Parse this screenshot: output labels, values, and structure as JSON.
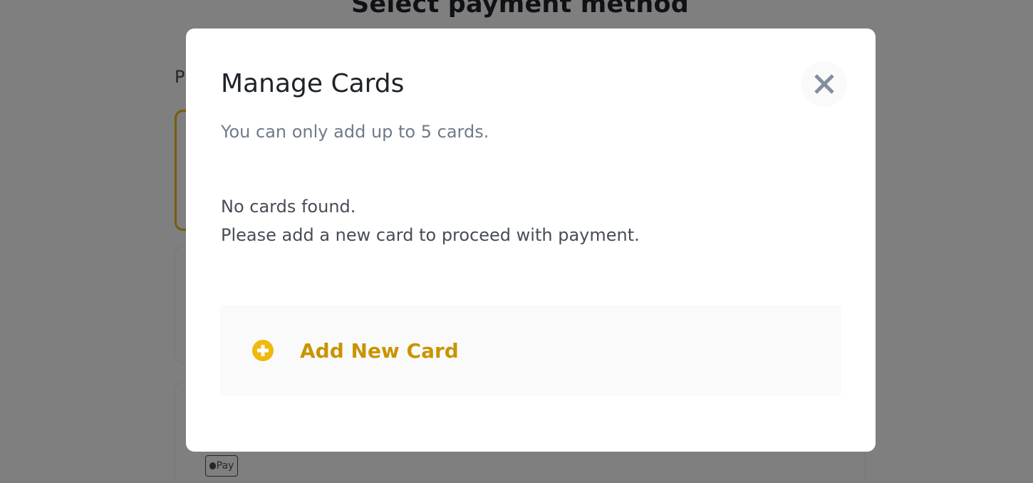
{
  "background": {
    "page_title": "Select payment method",
    "section_label": "P",
    "applepay_badge": "Pay"
  },
  "modal": {
    "title": "Manage Cards",
    "close_icon": "close-icon",
    "subtitle": "You can only add up to 5 cards.",
    "empty_line_1": "No cards found.",
    "empty_line_2": "Please add a new card to proceed with payment.",
    "add_card_label": "Add New Card",
    "add_card_icon": "plus-circle-icon"
  },
  "colors": {
    "accent": "#f0b90b",
    "accent_text": "#c99400",
    "overlay": "rgba(0,0,0,0.5)"
  }
}
